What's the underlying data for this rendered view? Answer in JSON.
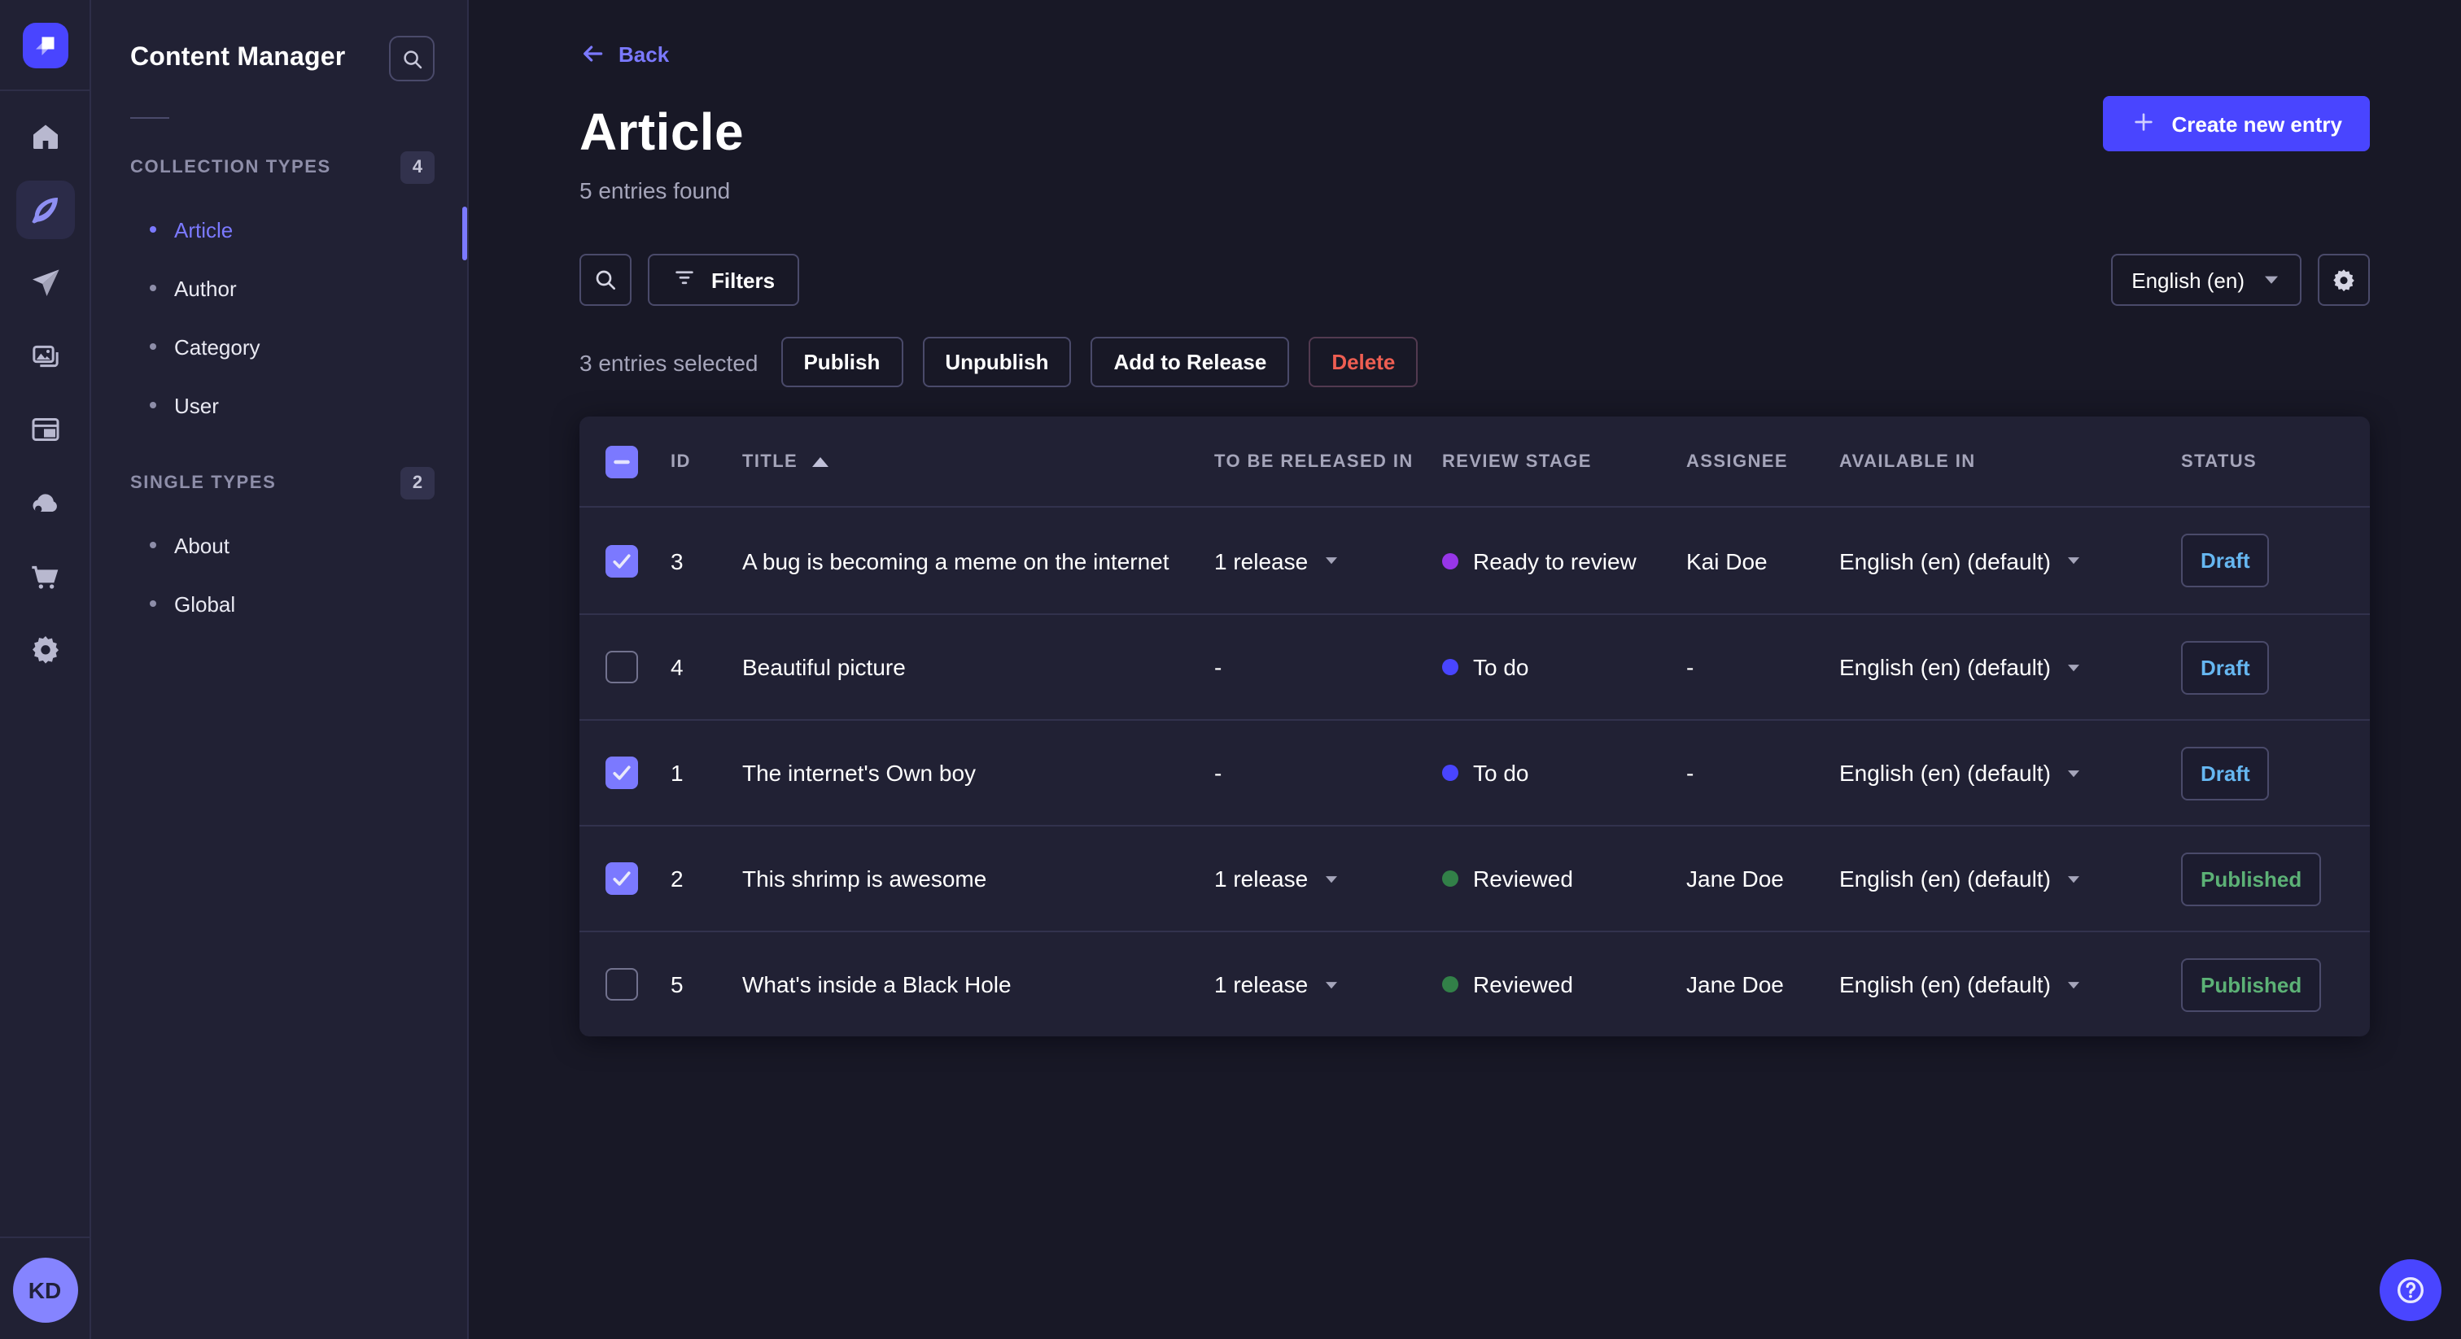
{
  "app": {
    "product": "Strapi admin",
    "theme": "dark"
  },
  "colors": {
    "accent": "#4945ff",
    "link": "#7b79ff",
    "page_bg": "#181826",
    "surface_bg": "#212134",
    "draft_text": "#66b7f1",
    "published_text": "#5cb176",
    "danger_text": "#ee5e52",
    "stage_todo": "#4945ff",
    "stage_ready_to_review": "#9736e8",
    "stage_reviewed": "#328048"
  },
  "rail": {
    "icons": [
      "home-icon",
      "content-manager-feather-icon",
      "releases-paper-plane-icon",
      "media-library-icon",
      "content-type-builder-icon",
      "cloud-icon",
      "marketplace-cart-icon",
      "settings-gear-icon"
    ],
    "active_icon": "content-manager-feather-icon",
    "avatar_initials": "KD"
  },
  "nav": {
    "title": "Content Manager",
    "search_icon": "search-icon",
    "sections": {
      "collection": {
        "label": "COLLECTION TYPES",
        "badge": "4",
        "items": [
          {
            "label": "Article",
            "active": true
          },
          {
            "label": "Author",
            "active": false
          },
          {
            "label": "Category",
            "active": false
          },
          {
            "label": "User",
            "active": false
          }
        ]
      },
      "single": {
        "label": "SINGLE TYPES",
        "badge": "2",
        "items": [
          {
            "label": "About",
            "active": false
          },
          {
            "label": "Global",
            "active": false
          }
        ]
      }
    }
  },
  "header": {
    "back": "Back",
    "title": "Article",
    "subtitle": "5 entries found",
    "create": "Create new entry"
  },
  "toolbar": {
    "filters": "Filters",
    "locale": "English (en)"
  },
  "selection": {
    "count_text": "3 entries selected",
    "publish": "Publish",
    "unpublish": "Unpublish",
    "add_to_release": "Add to Release",
    "delete": "Delete"
  },
  "table": {
    "headers": {
      "id": "ID",
      "title": "TITLE",
      "released": "TO BE RELEASED IN",
      "review": "REVIEW STAGE",
      "assignee": "ASSIGNEE",
      "available": "AVAILABLE IN",
      "status": "STATUS"
    },
    "sort": {
      "column": "TITLE",
      "direction": "asc"
    },
    "header_checkbox_state": "indeterminate",
    "rows": [
      {
        "checked": true,
        "id": "3",
        "title": "A bug is becoming a meme on the internet",
        "released": "1 release",
        "review_stage": "Ready to review",
        "assignee": "Kai Doe",
        "available": "English (en) (default)",
        "status": "Draft"
      },
      {
        "checked": false,
        "id": "4",
        "title": "Beautiful picture",
        "released": "-",
        "review_stage": "To do",
        "assignee": "-",
        "available": "English (en) (default)",
        "status": "Draft"
      },
      {
        "checked": true,
        "id": "1",
        "title": "The internet's Own boy",
        "released": "-",
        "review_stage": "To do",
        "assignee": "-",
        "available": "English (en) (default)",
        "status": "Draft"
      },
      {
        "checked": true,
        "id": "2",
        "title": "This shrimp is awesome",
        "released": "1 release",
        "review_stage": "Reviewed",
        "assignee": "Jane Doe",
        "available": "English (en) (default)",
        "status": "Published"
      },
      {
        "checked": false,
        "id": "5",
        "title": "What's inside a Black Hole",
        "released": "1 release",
        "review_stage": "Reviewed",
        "assignee": "Jane Doe",
        "available": "English (en) (default)",
        "status": "Published"
      }
    ]
  },
  "help": {
    "icon": "question-circle-icon"
  }
}
